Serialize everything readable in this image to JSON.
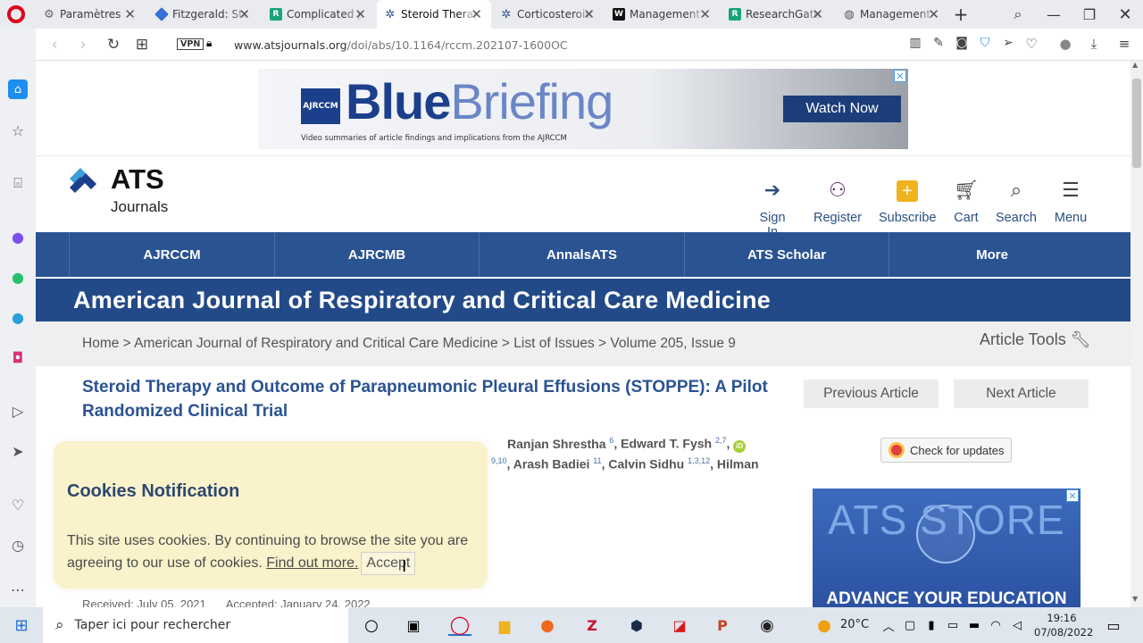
{
  "browser": {
    "tabs": [
      {
        "title": "Paramètres",
        "icon": "gear-icon",
        "color": "#666666"
      },
      {
        "title": "Fitzgerald: Steroid",
        "icon": "diamond-icon",
        "color": "#3a6fd8"
      },
      {
        "title": "Complicated parapneumonic",
        "icon": "r-icon",
        "color": "#19a47c"
      },
      {
        "title": "Steroid Therapy and Outcome",
        "icon": "ats-icon",
        "color": "#2a5392"
      },
      {
        "title": "Corticosteroids",
        "icon": "ats-icon",
        "color": "#2a5392"
      },
      {
        "title": "Management of",
        "icon": "w-icon",
        "color": "#111111"
      },
      {
        "title": "ResearchGate",
        "icon": "r-icon",
        "color": "#19a47c"
      },
      {
        "title": "Management of pleural",
        "icon": "globe-icon",
        "color": "#555555"
      }
    ],
    "vpn_label": "VPN",
    "url_domain": "www.atsjournals.org",
    "url_path": "/doi/abs/10.1164/rccm.202107-1600OC"
  },
  "banner": {
    "badge": "AJRCCM",
    "brand_bold": "Blue",
    "brand_light": "Briefing",
    "subtitle": "Video summaries of article findings and implications from the AJRCCM",
    "cta": "Watch Now"
  },
  "header": {
    "logo_main": "ATS",
    "logo_sub": "Journals",
    "actions": [
      "Sign In",
      "Register",
      "Subscribe",
      "Cart",
      "Search",
      "Menu"
    ]
  },
  "nav": [
    "AJRCCM",
    "AJRCMB",
    "AnnalsATS",
    "ATS Scholar",
    "More"
  ],
  "journal_title": "American Journal of Respiratory and Critical Care Medicine",
  "breadcrumb": "Home > American Journal of Respiratory and Critical Care Medicine > List of Issues > Volume 205, Issue 9",
  "article_tools": "Article Tools",
  "article": {
    "title": "Steroid Therapy and Outcome of Parapneumonic Pleural Effusions (STOPPE): A Pilot Randomized Clinical Trial",
    "authors_line1": {
      "a1": "Ranjan Shrestha",
      "s1": "6",
      "a2": "Edward T. Fysh",
      "s2": "2,7"
    },
    "authors_line2": {
      "s0": "9,10",
      "a1": "Arash Badiei",
      "s1": "11",
      "a2": "Calvin Sidhu",
      "s2": "1,3,12",
      "a3": "Hilman"
    },
    "received": "Received: July 05, 2021",
    "accepted": "Accepted: January 24, 2022"
  },
  "buttons": {
    "previous": "Previous Article",
    "next": "Next Article",
    "check_updates": "Check for updates"
  },
  "store_ad": {
    "title": "ATS STORE",
    "subtitle": "ADVANCE YOUR EDUCATION"
  },
  "cookie": {
    "title": "Cookies Notification",
    "text": "This site uses cookies. By continuing to browse the site you are agreeing to our use of cookies.",
    "link": "Find out more.",
    "accept": "Accept"
  },
  "taskbar": {
    "search_placeholder": "Taper ici pour rechercher",
    "temperature": "20°C",
    "time": "19:16",
    "date": "07/08/2022"
  }
}
